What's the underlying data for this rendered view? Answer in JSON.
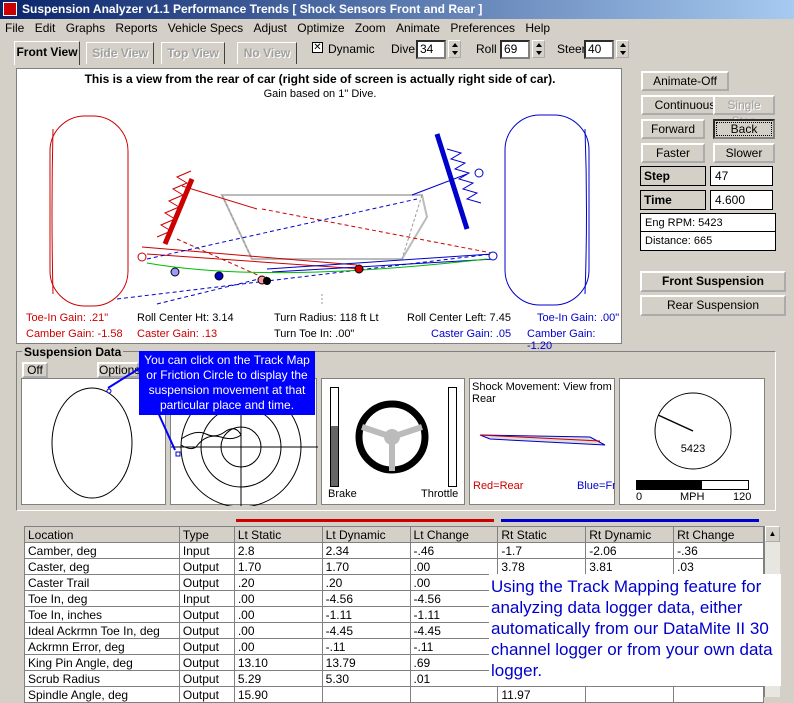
{
  "window": {
    "title": "Suspension Analyzer v1.1   Performance Trends   [ Shock Sensors Front and Rear ]",
    "min": "_",
    "max": "□",
    "close": "×"
  },
  "menu": [
    "File",
    "Edit",
    "Graphs",
    "Reports",
    "Vehicle Specs",
    "Adjust",
    "Optimize",
    "Zoom",
    "Animate",
    "Preferences",
    "Help"
  ],
  "tabs": [
    "Front View",
    "Side View",
    "Top View",
    "No View"
  ],
  "toolbar": {
    "dynamic_label": "Dynamic",
    "dive_label": "Dive",
    "dive": "34",
    "roll_label": "Roll",
    "roll": "69",
    "steer_label": "Steer",
    "steer": "40"
  },
  "view": {
    "heading": "This is a view from the rear of car (right side of screen is actually right side of car).",
    "subheading": "Gain based on 1\" Dive.",
    "stats": {
      "toe_in_left": "Toe-In Gain: .21\"",
      "camber_left": "Camber Gain: -1.58",
      "roll_center_ht": "Roll Center Ht: 3.14",
      "caster_left": "Caster Gain: .13",
      "turn_radius": "Turn Radius: 118 ft Lt",
      "turn_toe": "Turn Toe In: .00\"",
      "roll_center_left": "Roll Center Left: 7.45",
      "caster_right": "Caster Gain: .05",
      "toe_in_right": "Toe-In Gain: .00\"",
      "camber_right": "Camber Gain: -1.20"
    }
  },
  "side": {
    "animate_off": "Animate-Off",
    "continuous": "Continuous",
    "single_step": "Single Step",
    "forward": "Forward",
    "back": "Back",
    "faster": "Faster",
    "slower": "Slower",
    "step_label": "Step",
    "step": "47",
    "time_label": "Time",
    "time": "4.600",
    "eng_rpm": "Eng RPM:  5423",
    "distance": "Distance:  665",
    "front_suspension": "Front Suspension",
    "rear_suspension": "Rear Suspension"
  },
  "data_panel": {
    "title": "Suspension Data",
    "off": "Off",
    "options": "Options",
    "callout": "You can click on the Track Map or Friction Circle to display the suspension movement at that particular place and time.",
    "brake": "Brake",
    "throttle": "Throttle",
    "shock_title": "Shock Movement:  View from Rear",
    "red_rear": "Red=Rear",
    "blue_front": "Blue=Fro",
    "gauge_value": "5423",
    "gauge_zero": "0",
    "gauge_mph": "MPH",
    "gauge_max": "120"
  },
  "table": {
    "headers": [
      "Location",
      "Type",
      "Lt Static",
      "Lt Dynamic",
      "Lt Change",
      "Rt Static",
      "Rt Dynamic",
      "Rt Change"
    ],
    "rows": [
      [
        "Camber, deg",
        "Input",
        "2.8",
        "2.34",
        "-.46",
        "-1.7",
        "-2.06",
        "-.36"
      ],
      [
        "Caster, deg",
        "Output",
        "1.70",
        "1.70",
        ".00",
        "3.78",
        "3.81",
        ".03"
      ],
      [
        "Caster Trail",
        "Output",
        ".20",
        ".20",
        ".00",
        "",
        "",
        ""
      ],
      [
        "Toe In, deg",
        "Input",
        ".00",
        "-4.56",
        "-4.56",
        "",
        "",
        ""
      ],
      [
        "Toe In, inches",
        "Output",
        ".00",
        "-1.11",
        "-1.11",
        "",
        "",
        ""
      ],
      [
        "Ideal Ackrmn Toe In, deg",
        "Output",
        ".00",
        "-4.45",
        "-4.45",
        "",
        "",
        ""
      ],
      [
        "Ackrmn Error, deg",
        "Output",
        ".00",
        "-.11",
        "-.11",
        "",
        "",
        ""
      ],
      [
        "King Pin Angle, deg",
        "Output",
        "13.10",
        "13.79",
        ".69",
        "",
        "",
        ""
      ],
      [
        "Scrub Radius",
        "Output",
        "5.29",
        "5.30",
        ".01",
        "",
        "",
        ""
      ],
      [
        "Spindle Angle, deg",
        "Output",
        "15.90",
        "",
        "",
        "11.97",
        "",
        ""
      ]
    ]
  },
  "promo": "Using the Track Mapping feature for analyzing data logger data, either automatically from our DataMite II 30 channel logger or from your own data logger.",
  "colors": {
    "left": "#cc0000",
    "right": "#0000cc",
    "titlebar": "#0a246a"
  }
}
